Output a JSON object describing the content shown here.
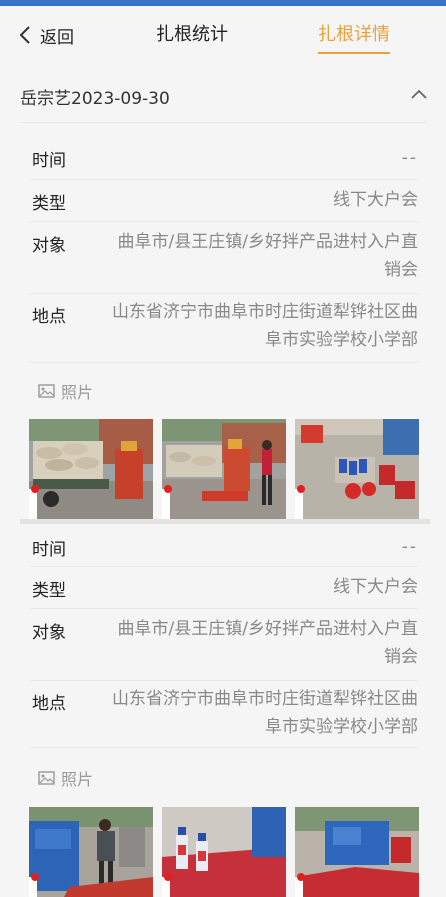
{
  "nav": {
    "back_label": "返回",
    "tabs": [
      "扎根统计",
      "扎根详情"
    ],
    "active_color": "#e9a23b"
  },
  "section": {
    "title": "岳宗艺2023-09-30"
  },
  "labels": {
    "time": "时间",
    "type": "类型",
    "target": "对象",
    "place": "地点",
    "photos": "照片"
  },
  "records": [
    {
      "time": "--",
      "type": "线下大户会",
      "target_line1": "曲阜市/县王庄镇/乡好拌产品进村入户直",
      "target_line2": "销会",
      "place_line1": "山东省济宁市曲阜市时庄街道犁铧社区曲",
      "place_line2": "阜市实验学校小学部",
      "photos": [
        "photo-truck-sacks",
        "photo-man-machine",
        "photo-bottles-ground"
      ]
    },
    {
      "time": "--",
      "type": "线下大户会",
      "target_line1": "曲阜市/县王庄镇/乡好拌产品进村入户直",
      "target_line2": "销会",
      "place_line1": "山东省济宁市曲阜市时庄街道犁铧社区曲",
      "place_line2": "阜市实验学校小学部",
      "photos": [
        "photo-blue-machine-man",
        "photo-bottles-red-seeds",
        "photo-blue-machine-seeds"
      ]
    }
  ]
}
